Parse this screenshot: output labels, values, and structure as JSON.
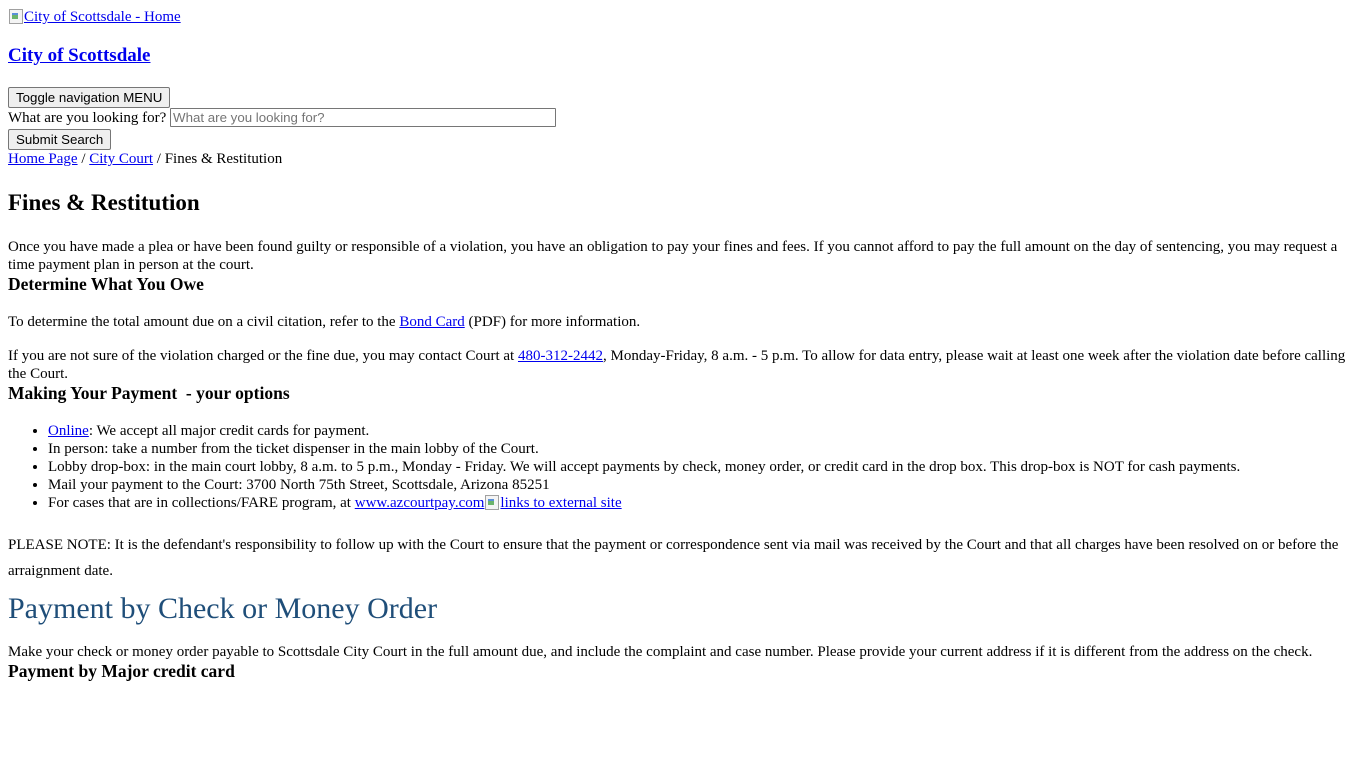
{
  "header": {
    "logo_alt": "City of Scottsdale - Home",
    "site_title": "City of Scottsdale",
    "toggle_nav_label": "Toggle navigation MENU",
    "search_label": "What are you looking for?",
    "search_placeholder": "What are you looking for?",
    "search_value": "",
    "submit_label": "Submit Search"
  },
  "breadcrumb": {
    "items": [
      "Home Page",
      "City Court"
    ],
    "current": "Fines & Restitution",
    "separator": "/"
  },
  "main": {
    "title": "Fines & Restitution",
    "intro": "Once you have made a plea or have been found guilty or responsible of a violation, you have an obligation to pay your fines and fees.  If you cannot afford to pay the full amount on the day of sentencing, you may request a time payment plan in person at the court.",
    "owe_heading": "Determine What You Owe",
    "bond_pre": "To determine the total amount due on a civil citation, refer to the ",
    "bond_link": "Bond Card",
    "bond_post": " (PDF) for more information.",
    "contact_pre": "If you are not sure of the violation charged or the fine due, you may contact Court at ",
    "contact_phone": "480-312-2442",
    "contact_post": ", Monday-Friday, 8 a.m. - 5 p.m. To allow for data entry, please wait at least one week after the violation date before calling the Court.",
    "payment_heading": "Making Your Payment  - your options",
    "options": {
      "online_link": "Online",
      "online_text": ": We accept all major credit cards for payment.",
      "in_person": "In person: take a number from the ticket dispenser in the main lobby of the Court.",
      "drop_box": "Lobby drop-box: in the main court lobby, 8 a.m. to 5 p.m., Monday - Friday. We will accept payments by check, money order, or credit card in the drop box. This drop-box is NOT for cash payments.",
      "mail": "Mail your payment to the Court: 3700 North 75th Street, Scottsdale, Arizona 85251",
      "collections_pre": "For cases that are in collections/FARE program, at ",
      "collections_link": "www.azcourtpay.com",
      "external_alt": "links to external site"
    },
    "note": "PLEASE NOTE: It is the defendant's responsibility to follow up with the Court to ensure that the payment or correspondence sent via mail was received by the Court and that all charges have been resolved on or before the arraignment date.",
    "check_heading": "Payment by Check or Money Order",
    "check_text": "Make your check or money order payable to Scottsdale City Court in the full amount due, and include the complaint and case number. Please provide your current address if it is different from the address on the check.",
    "card_heading": "Payment by Major credit card"
  },
  "colors": {
    "link": "#0000ee",
    "heading_blue": "#1f4e79"
  },
  "icons": {
    "logo": "broken-image-icon",
    "external": "broken-image-icon"
  }
}
